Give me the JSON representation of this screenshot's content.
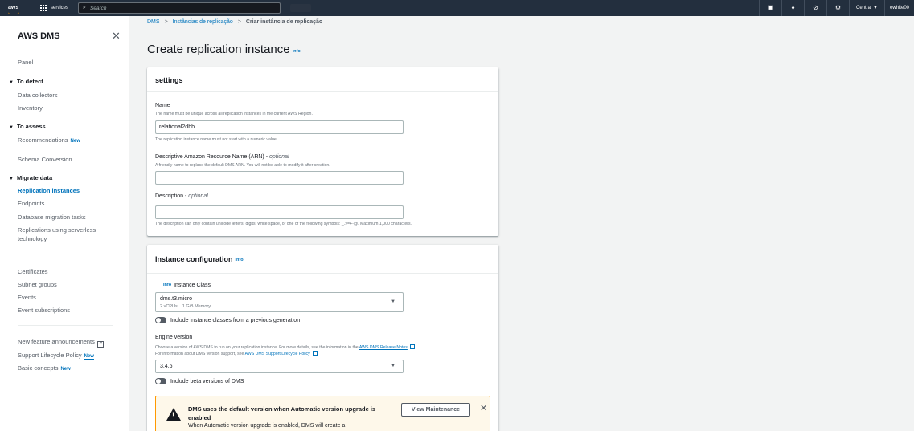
{
  "topnav": {
    "logo": "aws",
    "services_label": "services",
    "search_placeholder": "Search",
    "region": "Central",
    "region_caret": "▼",
    "user": "ewhite00"
  },
  "sidebar": {
    "title": "AWS DMS",
    "panel": "Panel",
    "detect": {
      "label": "To detect",
      "items": [
        "Data collectors",
        "Inventory"
      ]
    },
    "assess": {
      "label": "To assess",
      "recommendations": "Recommendations",
      "new": "New",
      "schema": "Schema Conversion"
    },
    "migrate": {
      "label": "Migrate data",
      "items": [
        "Replication instances",
        "Endpoints",
        "Database migration tasks",
        "Replications using serverless",
        "technology"
      ]
    },
    "other": [
      "Certificates",
      "Subnet groups",
      "Events",
      "Event subscriptions"
    ],
    "footer": {
      "announcements": "New feature announcements",
      "lifecycle": "Support Lifecycle Policy",
      "basic": "Basic concepts",
      "new": "New"
    }
  },
  "breadcrumb": {
    "root": "DMS",
    "mid": "Instâncias de replicação",
    "current": "Criar instância de replicação"
  },
  "page": {
    "title": "Create replication instance",
    "info": "Info"
  },
  "settings": {
    "header": "settings",
    "name_label": "Name",
    "name_desc": "The name must be unique across all replication instances in the current AWS Region.",
    "name_value": "relational2dbb",
    "name_hint": "The replication instance name must not start with a numeric value",
    "arn_label": "Descriptive Amazon Resource Name (ARN)",
    "arn_optional": "optional",
    "arn_desc": "A friendly name to replace the default DMS ARN. You will not be able to modify it after creation.",
    "arn_value": "",
    "desc_label": "Description",
    "desc_optional": "optional",
    "desc_value": "",
    "desc_hint": "The description can only contain unicode letters, digits, white space, or one of the following symbols: _.:/=+-@. Maximum 1,000 characters."
  },
  "instance": {
    "header": "Instance configuration",
    "info": "Info",
    "class_info": "Info",
    "class_label": "Instance Class",
    "class_value": "dms.t3.micro",
    "class_specs": "2 vCPUs    1 GiB Memory",
    "prev_gen": "Include instance classes from a previous generation",
    "engine_label": "Engine version",
    "engine_desc1": "Choose a version of AWS DMS to run on your replication instance. For more details, see the information in the",
    "engine_link1": "AWS DMS Release Notes",
    "engine_desc2": "For information about DMS version support, see",
    "engine_link2": "AWS DMS Support Lifecycle Policy",
    "engine_value": "3.4.6",
    "beta": "Include beta versions of DMS",
    "alert_title": "DMS uses the default version when Automatic version upgrade is enabled",
    "alert_body": "When Automatic version upgrade is enabled, DMS will create a",
    "alert_button": "View Maintenance"
  }
}
